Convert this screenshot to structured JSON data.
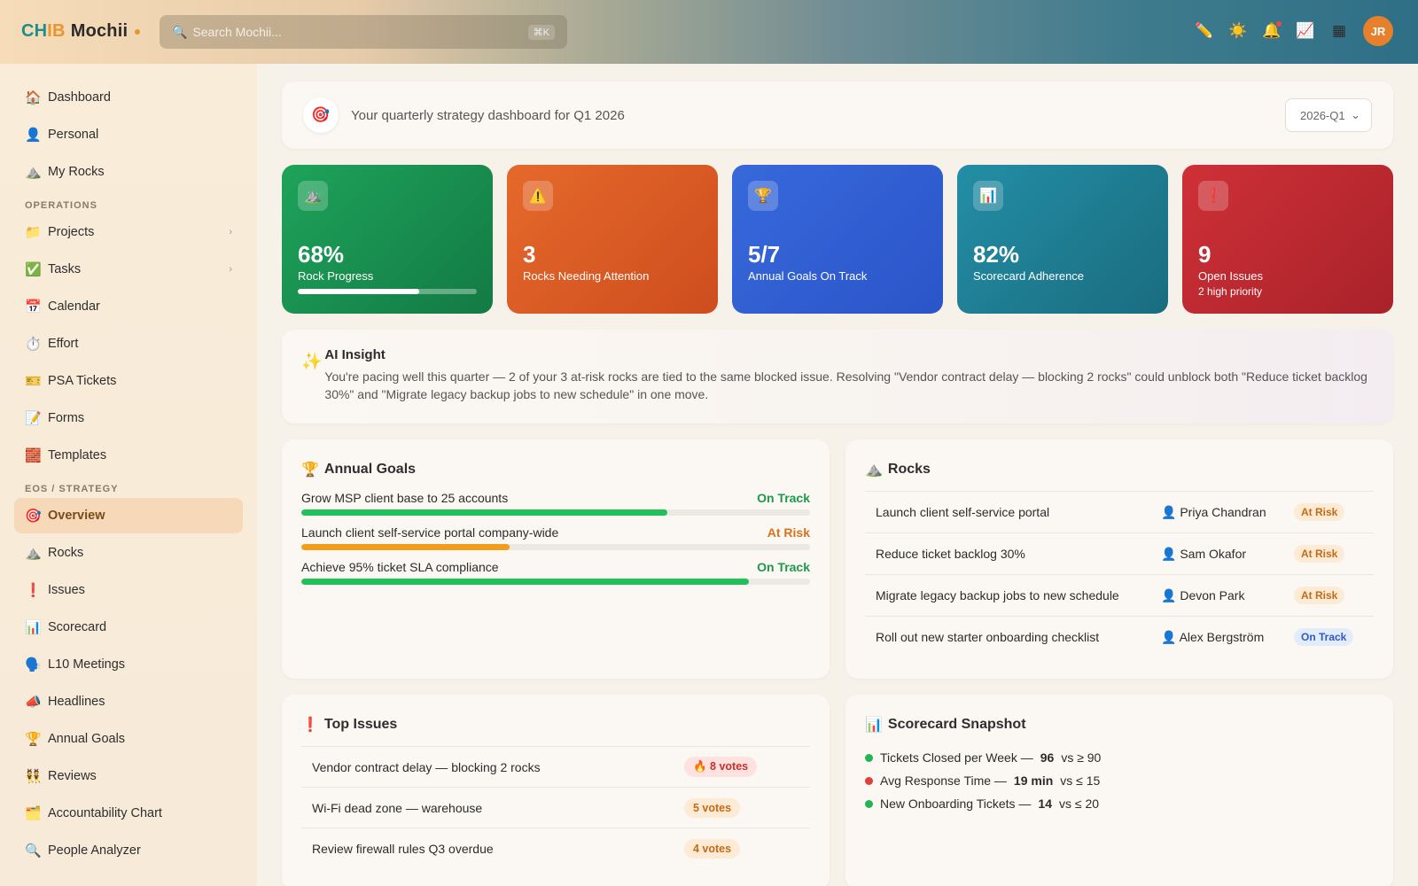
{
  "app": {
    "logo_part1": "CH",
    "logo_part2": "IB",
    "logo_name": "Mochii"
  },
  "search": {
    "placeholder": "Search Mochii...",
    "shortcut": "⌘K"
  },
  "topbar": {
    "avatar_initials": "JR"
  },
  "sidebar": {
    "items_top": [
      {
        "label": "Dashboard",
        "icon": "🏠"
      },
      {
        "label": "Personal",
        "icon": "👤"
      },
      {
        "label": "My Rocks",
        "icon": "⛰️"
      }
    ],
    "section_operations": "OPERATIONS",
    "items_ops": [
      {
        "label": "Projects",
        "icon": "📁"
      },
      {
        "label": "Tasks",
        "icon": "✅"
      },
      {
        "label": "Calendar",
        "icon": "📅"
      },
      {
        "label": "Effort",
        "icon": "⏱️"
      },
      {
        "label": "PSA Tickets",
        "icon": "🎫"
      },
      {
        "label": "Forms",
        "icon": "📝"
      },
      {
        "label": "Templates",
        "icon": "🧱"
      }
    ],
    "section_eos": "EOS / STRATEGY",
    "items_eos": [
      {
        "label": "Overview",
        "icon": "🎯"
      },
      {
        "label": "Rocks",
        "icon": "⛰️"
      },
      {
        "label": "Issues",
        "icon": "❗"
      },
      {
        "label": "Scorecard",
        "icon": "📊"
      },
      {
        "label": "L10 Meetings",
        "icon": "🗣️"
      },
      {
        "label": "Headlines",
        "icon": "📣"
      },
      {
        "label": "Annual Goals",
        "icon": "🏆"
      },
      {
        "label": "Reviews",
        "icon": "👯"
      },
      {
        "label": "Accountability Chart",
        "icon": "🗂️"
      },
      {
        "label": "People Analyzer",
        "icon": "🔍"
      }
    ]
  },
  "header": {
    "subtitle": "Your quarterly strategy dashboard for Q1 2026",
    "quarter": "2026-Q1"
  },
  "kpis": [
    {
      "value": "68%",
      "label": "Rock Progress",
      "progress": 0.68
    },
    {
      "value": "3",
      "label": "Rocks Needing Attention"
    },
    {
      "value": "5/7",
      "label": "Annual Goals On Track"
    },
    {
      "value": "82%",
      "label": "Scorecard Adherence"
    },
    {
      "value": "9",
      "label": "Open Issues",
      "sub": "2 high priority"
    }
  ],
  "insight": {
    "title": "AI Insight",
    "text": "You're pacing well this quarter — 2 of your 3 at-risk rocks are tied to the same blocked issue. Resolving \"Vendor contract delay — blocking 2 rocks\" could unblock both \"Reduce ticket backlog 30%\" and \"Migrate legacy backup jobs to new schedule\" in one move."
  },
  "annual_goals": {
    "title": "Annual Goals",
    "items": [
      {
        "label": "Grow MSP client base to 25 accounts",
        "status": "On Track",
        "progress": 0.72
      },
      {
        "label": "Launch client self-service portal company-wide",
        "status": "At Risk",
        "progress": 0.41
      },
      {
        "label": "Achieve 95% ticket SLA compliance",
        "status": "On Track",
        "progress": 0.88
      }
    ]
  },
  "rocks": {
    "title": "Rocks",
    "items": [
      {
        "title": "Launch client self-service portal",
        "owner": "Priya Chandran",
        "status": "At Risk"
      },
      {
        "title": "Reduce ticket backlog 30%",
        "owner": "Sam Okafor",
        "status": "At Risk"
      },
      {
        "title": "Migrate legacy backup jobs to new schedule",
        "owner": "Devon Park",
        "status": "At Risk"
      },
      {
        "title": "Roll out new starter onboarding checklist",
        "owner": "Alex Bergström",
        "status": "On Track"
      }
    ]
  },
  "top_issues": {
    "title": "Top Issues",
    "items": [
      {
        "title": "Vendor contract delay — blocking 2 rocks",
        "votes": "🔥 8 votes"
      },
      {
        "title": "Wi-Fi dead zone — warehouse",
        "votes": "5 votes"
      },
      {
        "title": "Review firewall rules Q3 overdue",
        "votes": "4 votes"
      }
    ]
  },
  "scorecard": {
    "title": "Scorecard Snapshot",
    "items": [
      {
        "name": "Tickets Closed per Week —",
        "value": "96",
        "target": "vs ≥ 90",
        "color": "#22b455"
      },
      {
        "name": "Avg Response Time —",
        "value": "19 min",
        "target": "vs ≤ 15",
        "color": "#e0403b"
      },
      {
        "name": "New Onboarding Tickets —",
        "value": "14",
        "target": "vs ≤ 20",
        "color": "#22b455"
      }
    ]
  },
  "colors": {
    "on_track": "#1c9a4a",
    "at_risk": "#d9731a",
    "goal_green": "#22c05a",
    "goal_orange": "#f29d1c"
  }
}
